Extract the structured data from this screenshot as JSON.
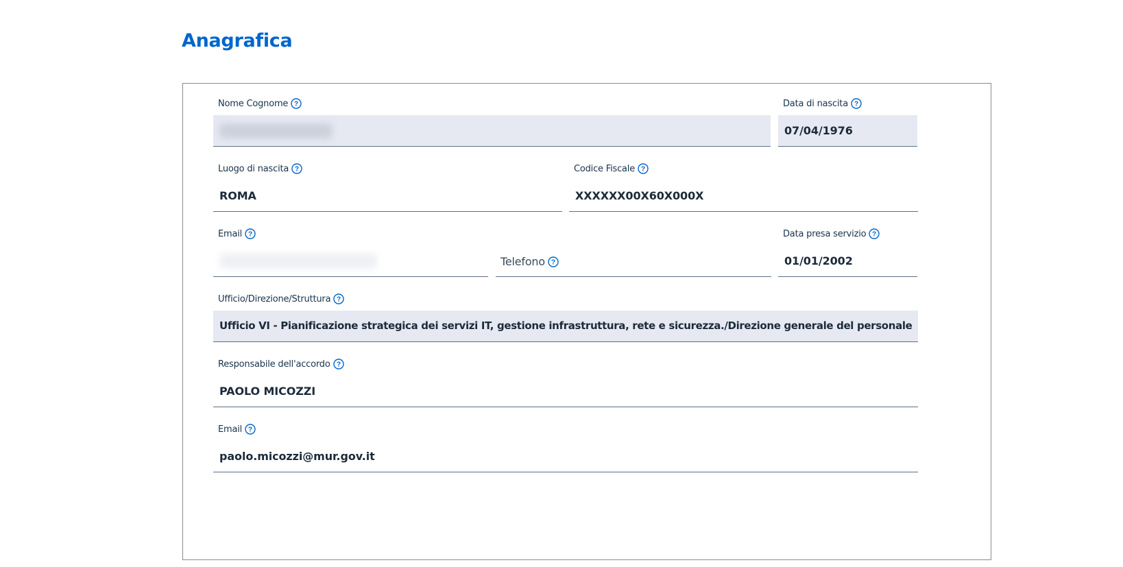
{
  "section": {
    "title": "Anagrafica"
  },
  "fields": {
    "nome_cognome": {
      "label": "Nome Cognome",
      "value": ""
    },
    "data_nascita": {
      "label": "Data di nascita",
      "value": "07/04/1976"
    },
    "luogo_nascita": {
      "label": "Luogo di nascita",
      "value": "ROMA"
    },
    "codice_fiscale": {
      "label": "Codice Fiscale",
      "value": "XXXXXX00X60X000X"
    },
    "email": {
      "label": "Email",
      "value": ""
    },
    "telefono": {
      "label": "Telefono",
      "value": ""
    },
    "data_presa_servizio": {
      "label": "Data presa servizio",
      "value": "01/01/2002"
    },
    "ufficio": {
      "label": "Ufficio/Direzione/Struttura",
      "value": "Ufficio VI - Pianificazione strategica dei servizi IT, gestione infrastruttura, rete e sicurezza./Direzione generale del personale, del bilancio"
    },
    "responsabile": {
      "label": "Responsabile dell'accordo",
      "value": "PAOLO MICOZZI"
    },
    "email_responsabile": {
      "label": "Email",
      "value": "paolo.micozzi@mur.gov.it"
    }
  },
  "icons": {
    "help": "question-circle-icon"
  },
  "colors": {
    "accent": "#0066cc",
    "readonly_bg": "#e6e9f2",
    "text": "#17324d",
    "border": "#5c6f82"
  }
}
